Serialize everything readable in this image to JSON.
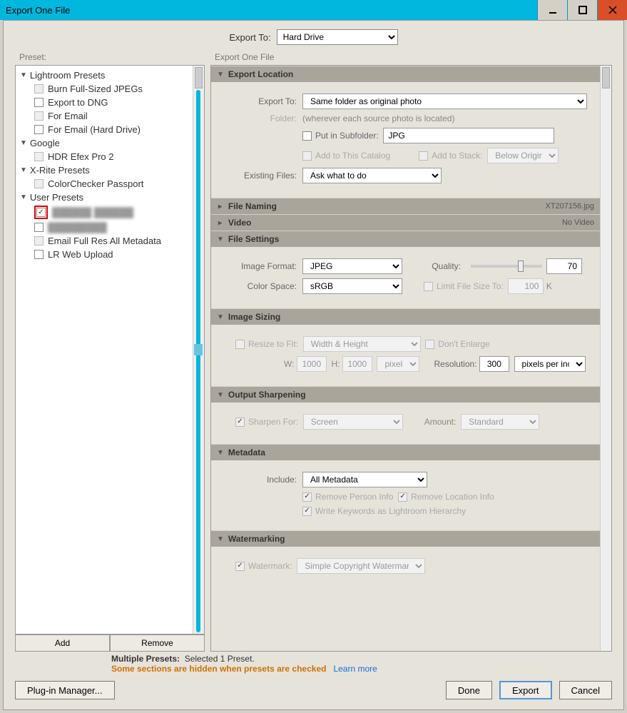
{
  "titlebar": {
    "title": "Export One File"
  },
  "export_to": {
    "label": "Export To:",
    "value": "Hard Drive"
  },
  "labels": {
    "preset": "Preset:",
    "export_one_file": "Export One File"
  },
  "tree": {
    "g1": "Lightroom Presets",
    "g1_items": [
      "Burn Full-Sized JPEGs",
      "Export to DNG",
      "For Email",
      "For Email (Hard Drive)"
    ],
    "g2": "Google",
    "g2_items": [
      "HDR Efex Pro 2"
    ],
    "g3": "X-Rite Presets",
    "g3_items": [
      "ColorChecker Passport"
    ],
    "g4": "User Presets",
    "g4_item3": "Email Full Res All Metadata",
    "g4_item4": "LR Web Upload"
  },
  "preset_btns": {
    "add": "Add",
    "remove": "Remove"
  },
  "s_location": {
    "title": "Export Location",
    "export_to": "Export To:",
    "export_to_val": "Same folder as original photo",
    "folder": "Folder:",
    "folder_val": "(wherever each source photo is located)",
    "put_sub": "Put in Subfolder:",
    "sub_val": "JPG",
    "add_cat": "Add to This Catalog",
    "add_stack": "Add to Stack:",
    "below": "Below Original",
    "existing": "Existing Files:",
    "existing_val": "Ask what to do"
  },
  "s_naming": {
    "title": "File Naming",
    "hint": "XT207156.jpg"
  },
  "s_video": {
    "title": "Video",
    "hint": "No Video"
  },
  "s_filesettings": {
    "title": "File Settings",
    "img_fmt": "Image Format:",
    "img_fmt_val": "JPEG",
    "quality": "Quality:",
    "quality_val": "70",
    "cspace": "Color Space:",
    "cspace_val": "sRGB",
    "limit": "Limit File Size To:",
    "limit_val": "100",
    "k": "K"
  },
  "s_sizing": {
    "title": "Image Sizing",
    "resize": "Resize to Fit:",
    "fit_val": "Width & Height",
    "dont_enlarge": "Don't Enlarge",
    "w": "W:",
    "w_val": "1000",
    "h": "H:",
    "h_val": "1000",
    "unit": "pixels",
    "res": "Resolution:",
    "res_val": "300",
    "res_unit": "pixels per inch"
  },
  "s_sharpen": {
    "title": "Output Sharpening",
    "sharpen_for": "Sharpen For:",
    "sf_val": "Screen",
    "amount": "Amount:",
    "amt_val": "Standard"
  },
  "s_meta": {
    "title": "Metadata",
    "include": "Include:",
    "include_val": "All Metadata",
    "rm_person": "Remove Person Info",
    "rm_loc": "Remove Location Info",
    "kw_hier": "Write Keywords as Lightroom Hierarchy"
  },
  "s_wm": {
    "title": "Watermarking",
    "wm": "Watermark:",
    "wm_val": "Simple Copyright Watermark"
  },
  "footer": {
    "mp": "Multiple Presets:",
    "sel": "Selected 1 Preset.",
    "warn": "Some sections are hidden when presets are checked",
    "learn": "Learn more",
    "plugin": "Plug-in Manager...",
    "done": "Done",
    "export": "Export",
    "cancel": "Cancel"
  }
}
